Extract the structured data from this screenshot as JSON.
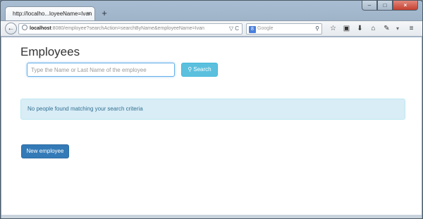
{
  "browser": {
    "tab_title": "http://localho...loyeeName=Ivan",
    "tab_close": "×",
    "new_tab": "+",
    "window_controls": {
      "minimize": "–",
      "maximize": "□",
      "close": "×"
    },
    "back": "←",
    "url_host": "localhost",
    "url_rest": ":8080/employee?searchAction=searchByName&employeeName=Ivan",
    "url_right": "▽ C",
    "search_engine_badge": "8",
    "search_placeholder": "Google",
    "toolbar_icons": [
      "star-icon",
      "clipboard-icon",
      "download-icon",
      "home-icon",
      "extension-icon",
      "dropdown-icon",
      "menu-icon"
    ]
  },
  "page": {
    "title": "Employees",
    "search": {
      "placeholder": "Type the Name or Last Name of the employee",
      "value": "",
      "button_label": "Search",
      "button_icon": "search-icon"
    },
    "alert": "No people found matching your search criteria",
    "new_button": "New employee"
  },
  "colors": {
    "info_button": "#5bc0de",
    "primary_button": "#337ab7",
    "alert_bg": "#d9edf7",
    "alert_text": "#31708f"
  }
}
